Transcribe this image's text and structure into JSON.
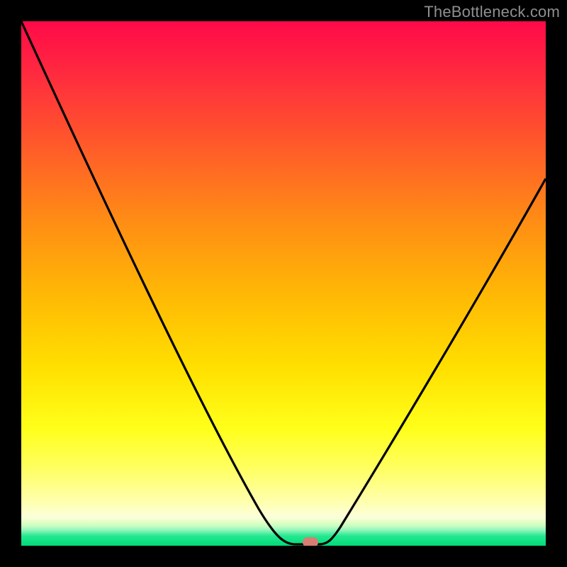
{
  "watermark": "TheBottleneck.com",
  "colors": {
    "frame": "#000000",
    "gradient_top": "#ff0a48",
    "gradient_mid": "#ffe000",
    "gradient_green": "#00db78",
    "curve": "#000000",
    "marker": "#d97c74"
  },
  "chart_data": {
    "type": "line",
    "title": "",
    "xlabel": "",
    "ylabel": "",
    "xlim": [
      0,
      100
    ],
    "ylim": [
      0,
      100
    ],
    "x": [
      0,
      3,
      6,
      9,
      12,
      15,
      18,
      21,
      24,
      27,
      30,
      33,
      36,
      39,
      42,
      45,
      48,
      50,
      51,
      52,
      53,
      54,
      55,
      56,
      58,
      61,
      64,
      67,
      70,
      73,
      76,
      79,
      82,
      85,
      88,
      91,
      94,
      97,
      100
    ],
    "values": [
      100,
      94.5,
      88.8,
      83.0,
      77.1,
      71.2,
      65.2,
      59.1,
      52.9,
      46.7,
      40.6,
      34.6,
      28.7,
      23.1,
      17.8,
      12.9,
      8.4,
      4.7,
      3.0,
      1.6,
      0.6,
      0.1,
      0.0,
      0.0,
      0.3,
      2.2,
      5.6,
      9.8,
      14.5,
      19.5,
      24.8,
      30.2,
      35.7,
      41.3,
      46.9,
      52.6,
      58.2,
      63.9,
      69.5
    ],
    "minimum_at_x": 55,
    "marker": {
      "x": 55,
      "y": 0
    },
    "grid": false,
    "legend": false
  }
}
